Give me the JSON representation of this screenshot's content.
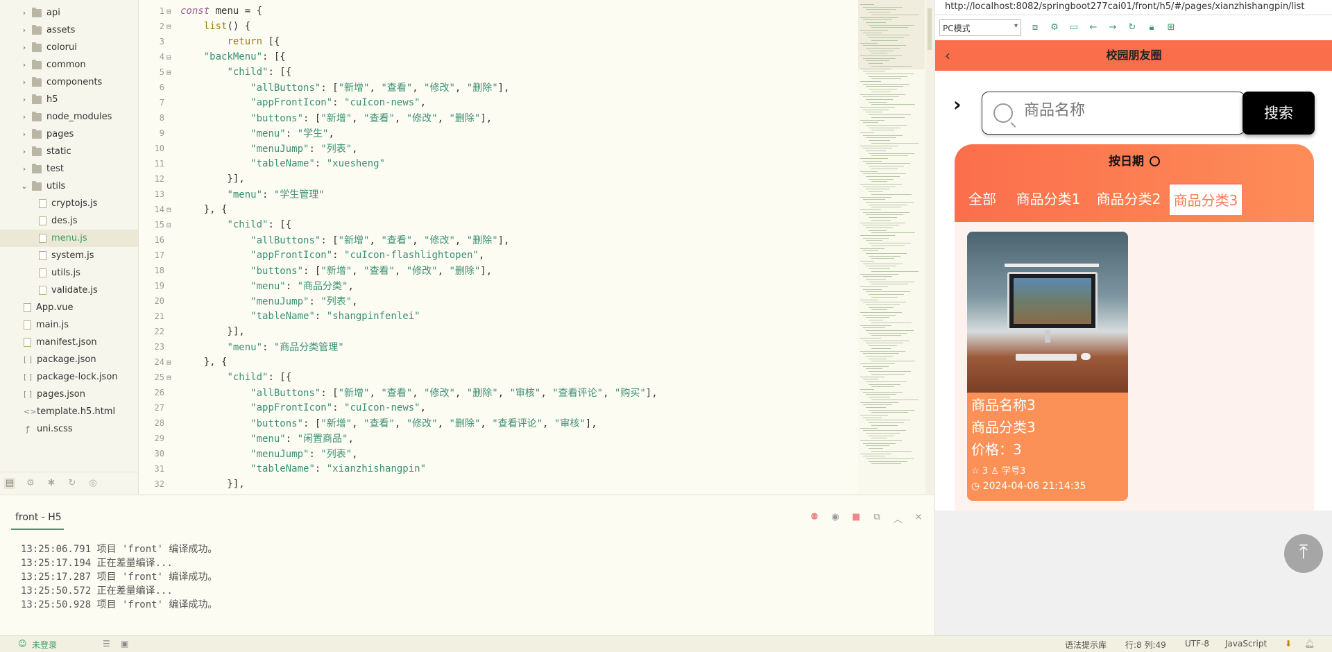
{
  "sidebar": {
    "items": [
      {
        "label": "api",
        "type": "folder",
        "level": 1
      },
      {
        "label": "assets",
        "type": "folder",
        "level": 1
      },
      {
        "label": "colorui",
        "type": "folder",
        "level": 1
      },
      {
        "label": "common",
        "type": "folder",
        "level": 1
      },
      {
        "label": "components",
        "type": "folder",
        "level": 1
      },
      {
        "label": "h5",
        "type": "folder",
        "level": 1
      },
      {
        "label": "node_modules",
        "type": "folder",
        "level": 1
      },
      {
        "label": "pages",
        "type": "folder",
        "level": 1
      },
      {
        "label": "static",
        "type": "folder",
        "level": 1
      },
      {
        "label": "test",
        "type": "folder",
        "level": 1
      },
      {
        "label": "utils",
        "type": "folder-open",
        "level": 1
      },
      {
        "label": "cryptojs.js",
        "type": "file",
        "level": 2
      },
      {
        "label": "des.js",
        "type": "file",
        "level": 2
      },
      {
        "label": "menu.js",
        "type": "file",
        "level": 2,
        "selected": true
      },
      {
        "label": "system.js",
        "type": "file",
        "level": 2
      },
      {
        "label": "utils.js",
        "type": "file",
        "level": 2
      },
      {
        "label": "validate.js",
        "type": "file",
        "level": 2
      },
      {
        "label": "App.vue",
        "type": "file",
        "level": 1
      },
      {
        "label": "main.js",
        "type": "file",
        "level": 1
      },
      {
        "label": "manifest.json",
        "type": "config",
        "level": 1
      },
      {
        "label": "package.json",
        "type": "json",
        "level": 1
      },
      {
        "label": "package-lock.json",
        "type": "json",
        "level": 1
      },
      {
        "label": "pages.json",
        "type": "json",
        "level": 1
      },
      {
        "label": "template.h5.html",
        "type": "html",
        "level": 1
      },
      {
        "label": "uni.scss",
        "type": "scss",
        "level": 1
      }
    ]
  },
  "editor": {
    "lines": [
      {
        "n": "1",
        "fold": "⊟",
        "html": "<span class='kf'>const</span> menu = {"
      },
      {
        "n": "2",
        "fold": "⊟",
        "html": "    <span class='fn'>list</span>() {"
      },
      {
        "n": "3",
        "fold": "",
        "html": "        <span class='fn'>return</span> [{"
      },
      {
        "n": "4",
        "fold": "⊟",
        "html": "    <span class='s'>\"backMenu\"</span>: [{"
      },
      {
        "n": "5",
        "fold": "⊟",
        "html": "        <span class='s'>\"child\"</span>: [{"
      },
      {
        "n": "6",
        "fold": "",
        "html": "            <span class='s'>\"allButtons\"</span>: [<span class='s'>\"新增\"</span>, <span class='s'>\"查看\"</span>, <span class='s'>\"修改\"</span>, <span class='s'>\"删除\"</span>],"
      },
      {
        "n": "7",
        "fold": "",
        "html": "            <span class='s'>\"appFrontIcon\"</span>: <span class='s'>\"cuIcon-news\"</span>,"
      },
      {
        "n": "8",
        "fold": "",
        "html": "            <span class='s'>\"buttons\"</span>: [<span class='s'>\"新增\"</span>, <span class='s'>\"查看\"</span>, <span class='s'>\"修改\"</span>, <span class='s'>\"删除\"</span>],"
      },
      {
        "n": "9",
        "fold": "",
        "html": "            <span class='s'>\"menu\"</span>: <span class='s'>\"学生\"</span>,"
      },
      {
        "n": "10",
        "fold": "",
        "html": "            <span class='s'>\"menuJump\"</span>: <span class='s'>\"列表\"</span>,"
      },
      {
        "n": "11",
        "fold": "",
        "html": "            <span class='s'>\"tableName\"</span>: <span class='s'>\"xuesheng\"</span>"
      },
      {
        "n": "12",
        "fold": "",
        "html": "        }],"
      },
      {
        "n": "13",
        "fold": "",
        "html": "        <span class='s'>\"menu\"</span>: <span class='s'>\"学生管理\"</span>"
      },
      {
        "n": "14",
        "fold": "⊟",
        "html": "    }, {"
      },
      {
        "n": "15",
        "fold": "⊟",
        "html": "        <span class='s'>\"child\"</span>: [{"
      },
      {
        "n": "16",
        "fold": "",
        "html": "            <span class='s'>\"allButtons\"</span>: [<span class='s'>\"新增\"</span>, <span class='s'>\"查看\"</span>, <span class='s'>\"修改\"</span>, <span class='s'>\"删除\"</span>],"
      },
      {
        "n": "17",
        "fold": "",
        "html": "            <span class='s'>\"appFrontIcon\"</span>: <span class='s'>\"cuIcon-flashlightopen\"</span>,"
      },
      {
        "n": "18",
        "fold": "",
        "html": "            <span class='s'>\"buttons\"</span>: [<span class='s'>\"新增\"</span>, <span class='s'>\"查看\"</span>, <span class='s'>\"修改\"</span>, <span class='s'>\"删除\"</span>],"
      },
      {
        "n": "19",
        "fold": "",
        "html": "            <span class='s'>\"menu\"</span>: <span class='s'>\"商品分类\"</span>,"
      },
      {
        "n": "20",
        "fold": "",
        "html": "            <span class='s'>\"menuJump\"</span>: <span class='s'>\"列表\"</span>,"
      },
      {
        "n": "21",
        "fold": "",
        "html": "            <span class='s'>\"tableName\"</span>: <span class='s'>\"shangpinfenlei\"</span>"
      },
      {
        "n": "22",
        "fold": "",
        "html": "        }],"
      },
      {
        "n": "23",
        "fold": "",
        "html": "        <span class='s'>\"menu\"</span>: <span class='s'>\"商品分类管理\"</span>"
      },
      {
        "n": "24",
        "fold": "⊟",
        "html": "    }, {"
      },
      {
        "n": "25",
        "fold": "⊟",
        "html": "        <span class='s'>\"child\"</span>: [{"
      },
      {
        "n": "26",
        "fold": "",
        "html": "            <span class='s'>\"allButtons\"</span>: [<span class='s'>\"新增\"</span>, <span class='s'>\"查看\"</span>, <span class='s'>\"修改\"</span>, <span class='s'>\"删除\"</span>, <span class='s'>\"审核\"</span>, <span class='s'>\"查看评论\"</span>, <span class='s'>\"购买\"</span>],"
      },
      {
        "n": "27",
        "fold": "",
        "html": "            <span class='s'>\"appFrontIcon\"</span>: <span class='s'>\"cuIcon-news\"</span>,"
      },
      {
        "n": "28",
        "fold": "",
        "html": "            <span class='s'>\"buttons\"</span>: [<span class='s'>\"新增\"</span>, <span class='s'>\"查看\"</span>, <span class='s'>\"修改\"</span>, <span class='s'>\"删除\"</span>, <span class='s'>\"查看评论\"</span>, <span class='s'>\"审核\"</span>],"
      },
      {
        "n": "29",
        "fold": "",
        "html": "            <span class='s'>\"menu\"</span>: <span class='s'>\"闲置商品\"</span>,"
      },
      {
        "n": "30",
        "fold": "",
        "html": "            <span class='s'>\"menuJump\"</span>: <span class='s'>\"列表\"</span>,"
      },
      {
        "n": "31",
        "fold": "",
        "html": "            <span class='s'>\"tableName\"</span>: <span class='s'>\"xianzhishangpin\"</span>"
      },
      {
        "n": "32",
        "fold": "",
        "html": "        }],"
      }
    ]
  },
  "console": {
    "tab": "front - H5",
    "logs": [
      "13:25:06.791 项目 'front' 编译成功。",
      "13:25:17.194 正在差量编译...",
      "13:25:17.287 项目 'front' 编译成功。",
      "13:25:50.572 正在差量编译...",
      "13:25:50.928 项目 'front' 编译成功。"
    ]
  },
  "statusbar": {
    "login": "未登录",
    "hint": "语法提示库",
    "position": "行:8  列:49",
    "encoding": "UTF-8",
    "language": "JavaScript"
  },
  "preview": {
    "url": "http://localhost:8082/springboot277cai01/front/h5/#/pages/xianzhishangpin/list",
    "mode": "PC模式",
    "app_title": "校园朋友圈",
    "search_placeholder": "商品名称",
    "search_button": "搜索",
    "date_sort": "按日期",
    "tabs": [
      "全部",
      "商品分类1",
      "商品分类2",
      "商品分类3"
    ],
    "active_tab": 3,
    "product": {
      "name": "商品名称3",
      "category": "商品分类3",
      "price": "价格：3",
      "stars": "3",
      "user": "学号3",
      "date": "2024-04-06 21:14:35"
    }
  }
}
